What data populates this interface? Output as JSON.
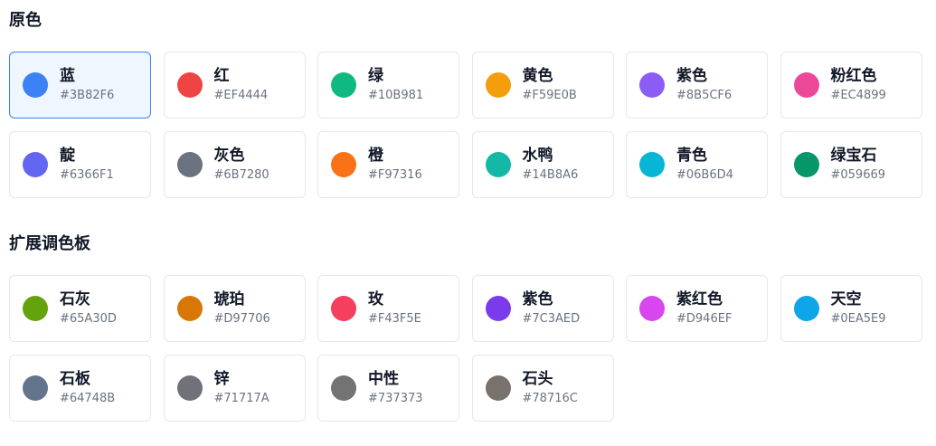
{
  "sections": [
    {
      "title": "原色",
      "selected_index": 0,
      "swatches": [
        {
          "name": "蓝",
          "hex": "#3B82F6"
        },
        {
          "name": "红",
          "hex": "#EF4444"
        },
        {
          "name": "绿",
          "hex": "#10B981"
        },
        {
          "name": "黄色",
          "hex": "#F59E0B"
        },
        {
          "name": "紫色",
          "hex": "#8B5CF6"
        },
        {
          "name": "粉红色",
          "hex": "#EC4899"
        },
        {
          "name": "靛",
          "hex": "#6366F1"
        },
        {
          "name": "灰色",
          "hex": "#6B7280"
        },
        {
          "name": "橙",
          "hex": "#F97316"
        },
        {
          "name": "水鸭",
          "hex": "#14B8A6"
        },
        {
          "name": "青色",
          "hex": "#06B6D4"
        },
        {
          "name": "绿宝石",
          "hex": "#059669"
        }
      ]
    },
    {
      "title": "扩展调色板",
      "selected_index": -1,
      "swatches": [
        {
          "name": "石灰",
          "hex": "#65A30D"
        },
        {
          "name": "琥珀",
          "hex": "#D97706"
        },
        {
          "name": "玫",
          "hex": "#F43F5E"
        },
        {
          "name": "紫色",
          "hex": "#7C3AED"
        },
        {
          "name": "紫红色",
          "hex": "#D946EF"
        },
        {
          "name": "天空",
          "hex": "#0EA5E9"
        },
        {
          "name": "石板",
          "hex": "#64748B"
        },
        {
          "name": "锌",
          "hex": "#71717A"
        },
        {
          "name": "中性",
          "hex": "#737373"
        },
        {
          "name": "石头",
          "hex": "#78716C"
        }
      ]
    }
  ],
  "colors": {
    "selected_border": "#3b82f6",
    "selected_background": "#eff6ff"
  }
}
